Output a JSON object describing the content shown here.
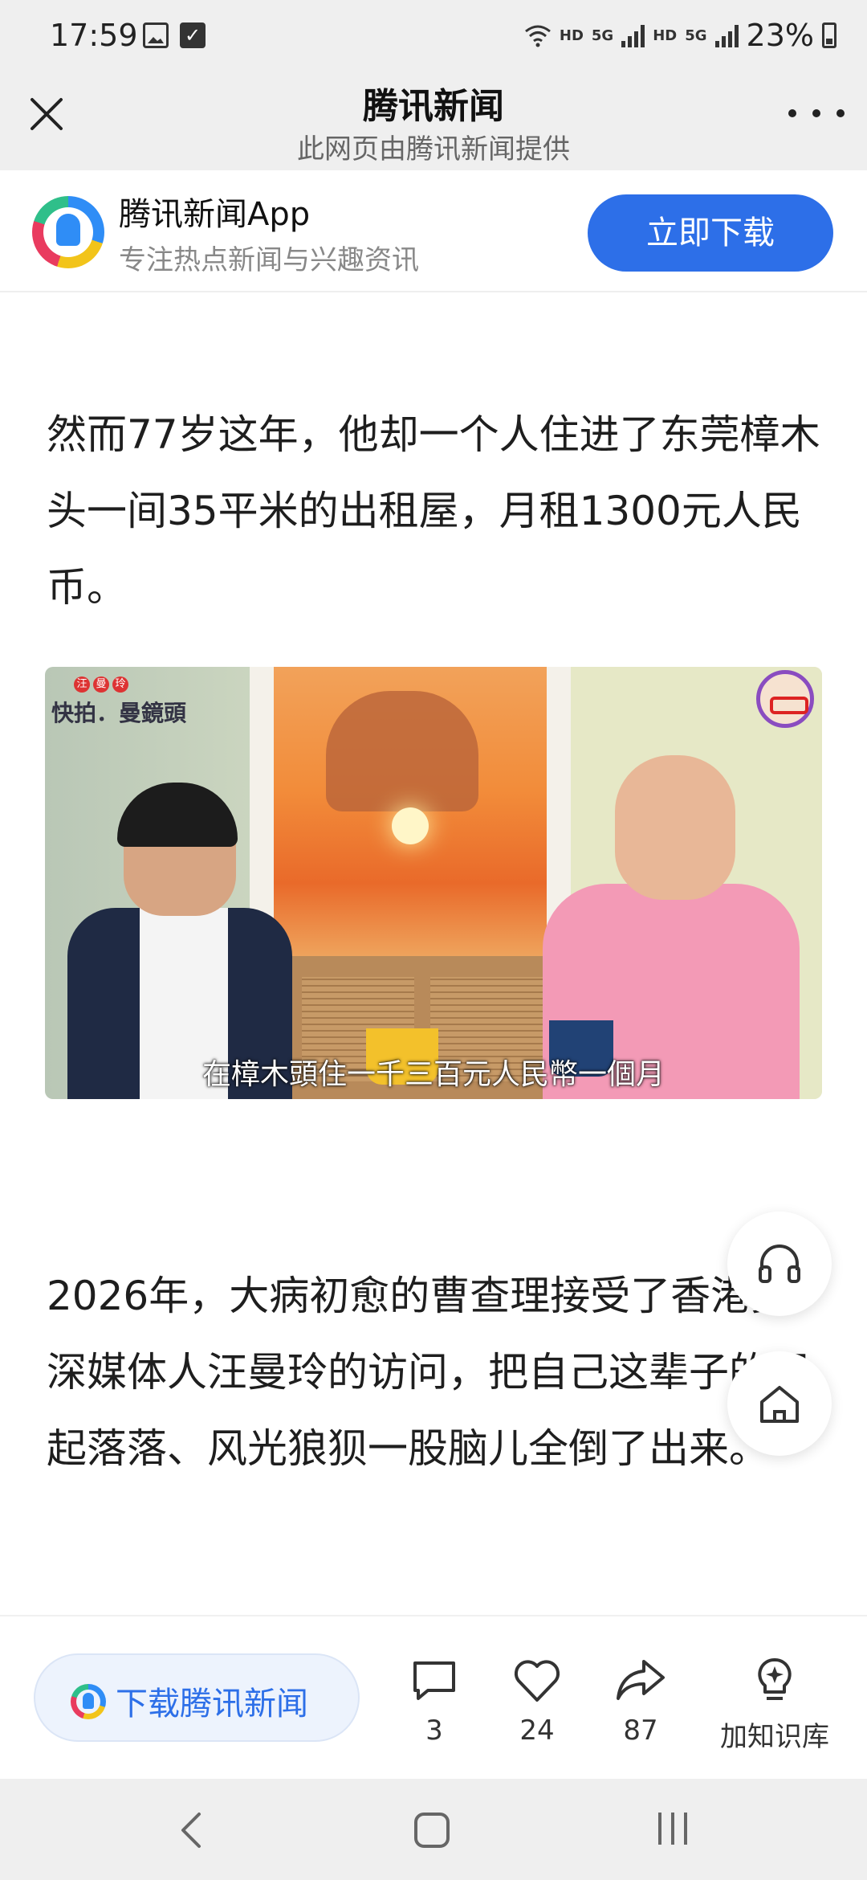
{
  "status_bar": {
    "time": "17:59",
    "wifi_label": "HD",
    "network1": "5G",
    "hd2": "HD",
    "network2": "5G",
    "battery": "23%"
  },
  "header": {
    "title": "腾讯新闻",
    "subtitle": "此网页由腾讯新闻提供"
  },
  "app_banner": {
    "name": "腾讯新闻App",
    "tagline": "专注热点新闻与兴趣资讯",
    "download_label": "立即下载"
  },
  "article": {
    "paragraph1": "然而77岁这年，他却一个人住进了东莞樟木头一间35平米的出租屋，月租1300元人民币。",
    "image": {
      "watermark": "快拍．曼鏡頭",
      "badge_chars": [
        "汪",
        "曼",
        "玲"
      ],
      "subtitle": "在樟木頭住一千三百元人民幣一個月"
    },
    "paragraph2": "2026年，大病初愈的曹查理接受了香港资深媒体人汪曼玲的访问，把自己这辈子的起起落落、风光狼狈一股脑儿全倒了出来。"
  },
  "bottom_bar": {
    "download_label": "下载腾讯新闻",
    "comments": "3",
    "likes": "24",
    "shares": "87",
    "knowledge_label": "加知识库"
  },
  "colors": {
    "accent": "#2d6fe8",
    "chrome": "#efefef"
  }
}
